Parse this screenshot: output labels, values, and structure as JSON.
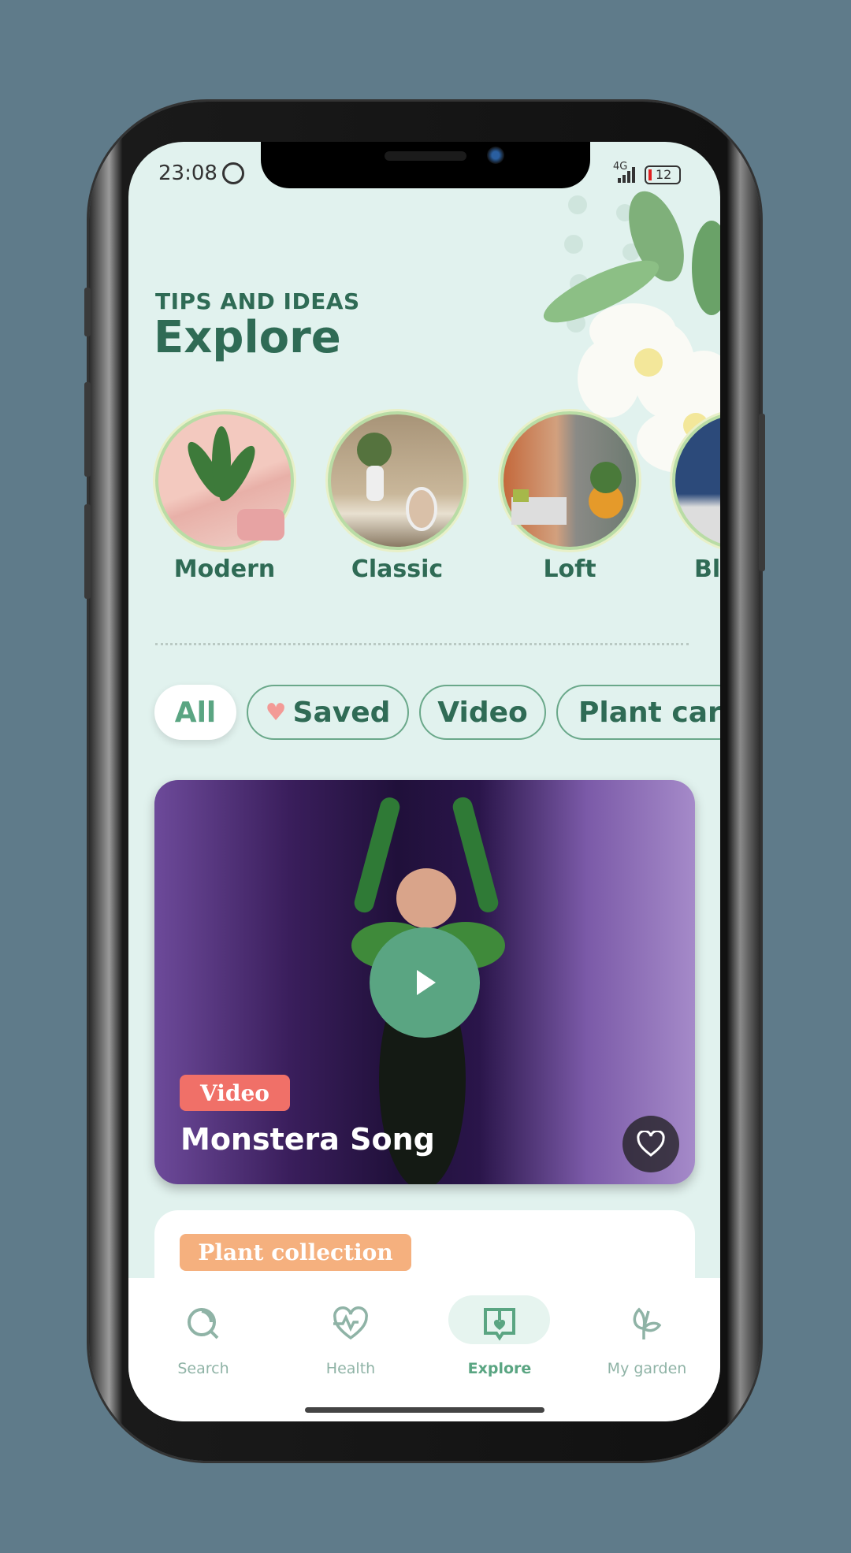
{
  "status_bar": {
    "time": "23:08",
    "battery": "12",
    "network": "4G"
  },
  "header": {
    "subtitle": "TIPS AND IDEAS",
    "title": "Explore"
  },
  "categories": [
    {
      "label": "Modern"
    },
    {
      "label": "Classic"
    },
    {
      "label": "Loft"
    },
    {
      "label": "Blue"
    }
  ],
  "filters": [
    {
      "label": "All",
      "active": true
    },
    {
      "label": "Saved",
      "icon": "heart-icon"
    },
    {
      "label": "Video"
    },
    {
      "label": "Plant care"
    }
  ],
  "cards": [
    {
      "badge": "Video",
      "title": "Monstera Song",
      "badge_color": "#f07068"
    },
    {
      "badge": "Plant collection",
      "badge_color": "#f5b07e"
    }
  ],
  "nav": [
    {
      "label": "Search",
      "icon": "search-icon"
    },
    {
      "label": "Health",
      "icon": "heart-pulse-icon"
    },
    {
      "label": "Explore",
      "icon": "book-heart-icon",
      "active": true
    },
    {
      "label": "My garden",
      "icon": "sprout-icon"
    }
  ],
  "colors": {
    "accent": "#5aa582",
    "text": "#2f6b55",
    "background": "#e1f2ee"
  }
}
